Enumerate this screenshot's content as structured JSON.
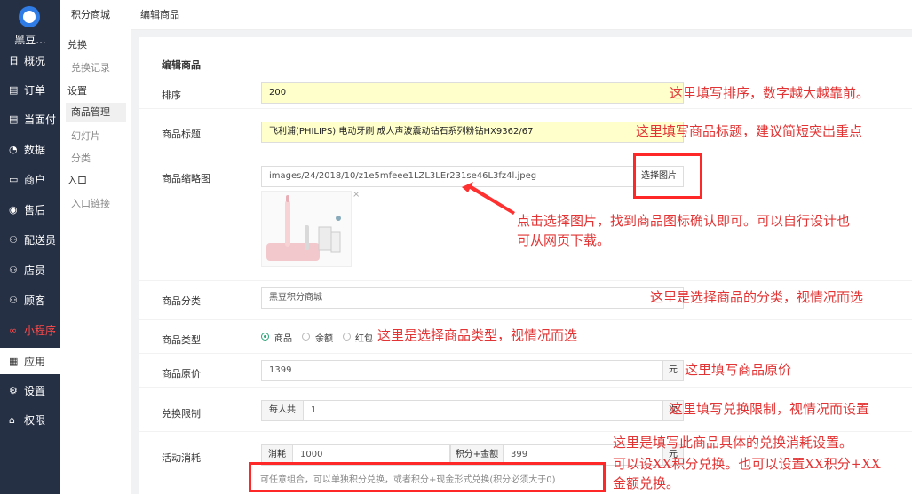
{
  "nav": {
    "shop_name": "黑豆...",
    "items": [
      {
        "label": "概况",
        "icon": "日"
      },
      {
        "label": "订单",
        "icon": "▤"
      },
      {
        "label": "当面付",
        "icon": "▤"
      },
      {
        "label": "数据",
        "icon": "◔"
      },
      {
        "label": "商户",
        "icon": "▭"
      },
      {
        "label": "售后",
        "icon": "◉"
      },
      {
        "label": "配送员",
        "icon": "⚇"
      },
      {
        "label": "店员",
        "icon": "⚇"
      },
      {
        "label": "顾客",
        "icon": "⚇"
      },
      {
        "label": "小程序",
        "icon": "∞"
      },
      {
        "label": "应用",
        "icon": "▦"
      },
      {
        "label": "设置",
        "icon": "⚙"
      },
      {
        "label": "权限",
        "icon": "⌂"
      }
    ]
  },
  "subnav": {
    "header": "积分商城",
    "g1": "兑换",
    "l1": "兑换记录",
    "g2": "设置",
    "l2": "商品管理",
    "l3": "幻灯片",
    "l4": "分类",
    "g3": "入口",
    "l5": "入口链接"
  },
  "topbar": {
    "title": "编辑商品"
  },
  "form": {
    "section_title": "编辑商品",
    "sort": {
      "label": "排序",
      "value": "200"
    },
    "title": {
      "label": "商品标题",
      "value": "飞利浦(PHILIPS) 电动牙刷 成人声波震动钻石系列粉钻HX9362/67"
    },
    "thumb": {
      "label": "商品缩略图",
      "value": "images/24/2018/10/z1e5mfeee1LZL3LEr231se46L3fz4l.jpeg",
      "button": "选择图片",
      "remove": "×"
    },
    "category": {
      "label": "商品分类",
      "value": "黑豆积分商城"
    },
    "type": {
      "label": "商品类型",
      "options": [
        "商品",
        "余额",
        "红包"
      ]
    },
    "price": {
      "label": "商品原价",
      "value": "1399",
      "unit": "元"
    },
    "limit": {
      "label": "兑换限制",
      "prefix": "每人共",
      "value": "1",
      "unit": "次"
    },
    "cost": {
      "label": "活动消耗",
      "prefix1": "消耗",
      "value1": "1000",
      "prefix2": "积分+金额",
      "value2": "399",
      "unit": "元",
      "hint": "可任意组合，可以单独积分兑换，或者积分+现金形式兑换(积分必须大于0)"
    }
  },
  "annotations": {
    "a1": "这里填写排序，数字越大越靠前。",
    "a2": "这里填写商品标题，建议简短突出重点",
    "a3a": "点击选择图片，找到商品图标确认即可。可以自行设计也",
    "a3b": "可从网页下载。",
    "a4": "这里是选择商品的分类，视情况而选",
    "a5": "这里是选择商品类型，视情况而选",
    "a6": "这里填写商品原价",
    "a7": "这里填写兑换限制，视情况而设置",
    "a8a": "这里是填写此商品具体的兑换消耗设置。",
    "a8b": "可以设XX积分兑换。也可以设置XX积分+XX",
    "a8c": "金额兑换。"
  },
  "colors": {
    "nav_bg": "#263044",
    "annotation": "#e23434",
    "highlight_input": "#ffffcc"
  }
}
